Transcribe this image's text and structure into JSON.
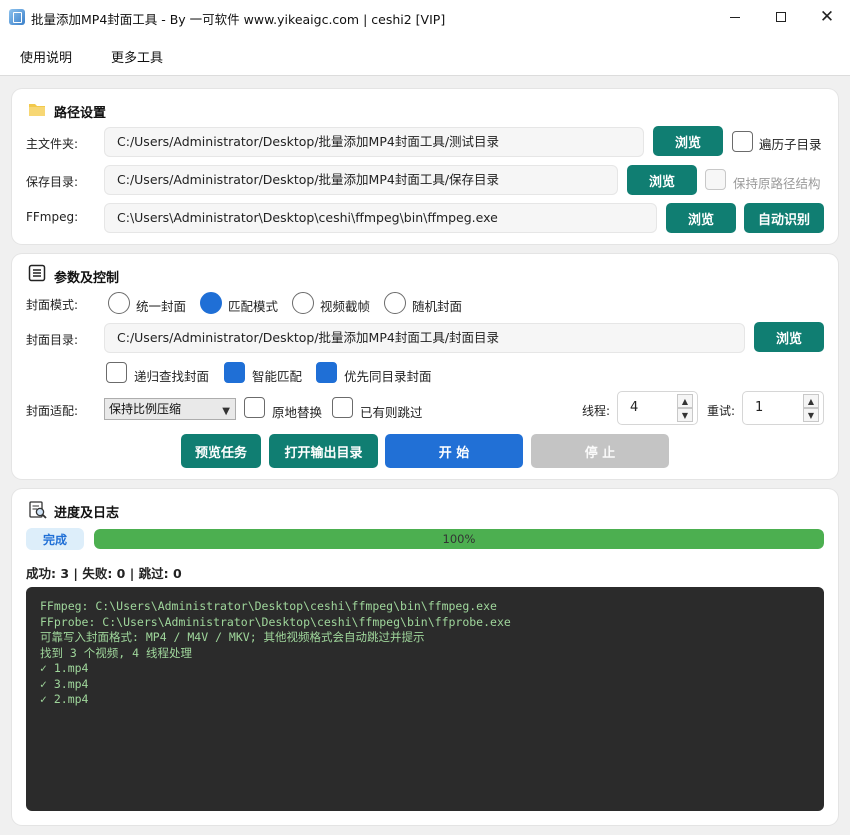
{
  "window": {
    "title": "批量添加MP4封面工具 - By 一可软件 www.yikeaigc.com | ceshi2 [VIP]",
    "minimize_icon": "minimize-icon",
    "maximize_icon": "maximize-icon",
    "close_icon": "close-icon"
  },
  "menu": {
    "items": [
      "使用说明",
      "更多工具"
    ]
  },
  "path_section": {
    "title": "路径设置",
    "icon": "folder-icon",
    "main_folder": {
      "label": "主文件夹:",
      "value": "C:/Users/Administrator/Desktop/批量添加MP4封面工具/测试目录",
      "browse": "浏览",
      "checkbox_label": "遍历子目录",
      "checked": false
    },
    "save_dir": {
      "label": "保存目录:",
      "value": "C:/Users/Administrator/Desktop/批量添加MP4封面工具/保存目录",
      "browse": "浏览",
      "checkbox_label": "保持原路径结构",
      "checked": false,
      "disabled": true
    },
    "ffmpeg": {
      "label": "FFmpeg:",
      "value": "C:\\Users\\Administrator\\Desktop\\ceshi\\ffmpeg\\bin\\ffmpeg.exe",
      "browse": "浏览",
      "auto_detect": "自动识别"
    }
  },
  "params_section": {
    "title": "参数及控制",
    "icon": "list-icon",
    "cover_mode": {
      "label": "封面模式:",
      "options": [
        "统一封面",
        "匹配模式",
        "视频截帧",
        "随机封面"
      ],
      "selected": "匹配模式"
    },
    "cover_dir": {
      "label": "封面目录:",
      "value": "C:/Users/Administrator/Desktop/批量添加MP4封面工具/封面目录",
      "browse": "浏览"
    },
    "options": [
      {
        "label": "递归查找封面",
        "checked": false
      },
      {
        "label": "智能匹配",
        "checked": true
      },
      {
        "label": "优先同目录封面",
        "checked": true
      }
    ],
    "fit": {
      "label": "封面适配:",
      "selected": "保持比例压缩",
      "replace_label": "原地替换",
      "replace_checked": false,
      "skip_label": "已有则跳过",
      "skip_checked": false
    },
    "threads": {
      "label": "线程:",
      "value": "4"
    },
    "retry": {
      "label": "重试:",
      "value": "1"
    },
    "buttons": {
      "preview": "预览任务",
      "open_output": "打开输出目录",
      "start": "开 始",
      "stop": "停 止"
    }
  },
  "progress_section": {
    "title": "进度及日志",
    "icon": "search-log-icon",
    "status": "完成",
    "progress": 1.0,
    "progress_text": "100%",
    "stats": "成功: 3  |  失败: 0  |  跳过: 0",
    "log": [
      "FFmpeg: C:\\Users\\Administrator\\Desktop\\ceshi\\ffmpeg\\bin\\ffmpeg.exe",
      "FFprobe: C:\\Users\\Administrator\\Desktop\\ceshi\\ffmpeg\\bin\\ffprobe.exe",
      "可靠写入封面格式: MP4 / M4V / MKV; 其他视频格式会自动跳过并提示",
      "找到 3 个视频, 4 线程处理",
      "✓ 1.mp4",
      "✓ 3.mp4",
      "✓ 2.mp4"
    ]
  },
  "colors": {
    "teal_button": "#107e72",
    "blue_accent": "#2170d6",
    "progress_green": "#4caf50",
    "log_bg": "#2b2b2b",
    "log_text": "#9fd69b"
  }
}
